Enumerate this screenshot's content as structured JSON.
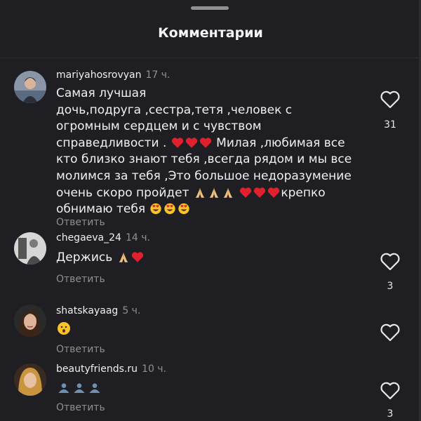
{
  "sheet": {
    "title": "Комментарии"
  },
  "comments": [
    {
      "username": "mariyahosrovyan",
      "time": "17 ч.",
      "text_lines": [
        "Самая лучшая",
        "дочь,подруга ,сестра,тетя ,человек с",
        "огромным сердцем и с чувством",
        "справедливости .",
        "Милая ,любимая все",
        "кто близко знают тебя ,всегда рядом и мы все",
        "молимся за тебя ,Это большое недоразумение",
        "очень скоро  пройдет",
        "крепко",
        "обнимаю тебя"
      ],
      "reply_label": "Ответить",
      "likes": "31"
    },
    {
      "username": "chegaeva_24",
      "time": "14 ч.",
      "text": "Держись",
      "reply_label": "Ответить",
      "likes": "3"
    },
    {
      "username": "shatskayaag",
      "time": "5 ч.",
      "text": "",
      "reply_label": "Ответить",
      "likes": ""
    },
    {
      "username": "beautyfriends.ru",
      "time": "10 ч.",
      "text": "",
      "reply_label": "Ответить",
      "likes": "3"
    }
  ],
  "icons": {
    "like": "heart-outline-icon",
    "emoji_heart": "red-heart-emoji",
    "emoji_pray": "praying-hands-emoji",
    "emoji_heart_eyes": "heart-eyes-emoji",
    "emoji_surprised": "surprised-face-emoji",
    "emoji_people": "busts-silhouette-emoji"
  },
  "colors": {
    "background": "#1f1f23",
    "muted_text": "#8e8e93",
    "heart_red": "#e0202e"
  }
}
